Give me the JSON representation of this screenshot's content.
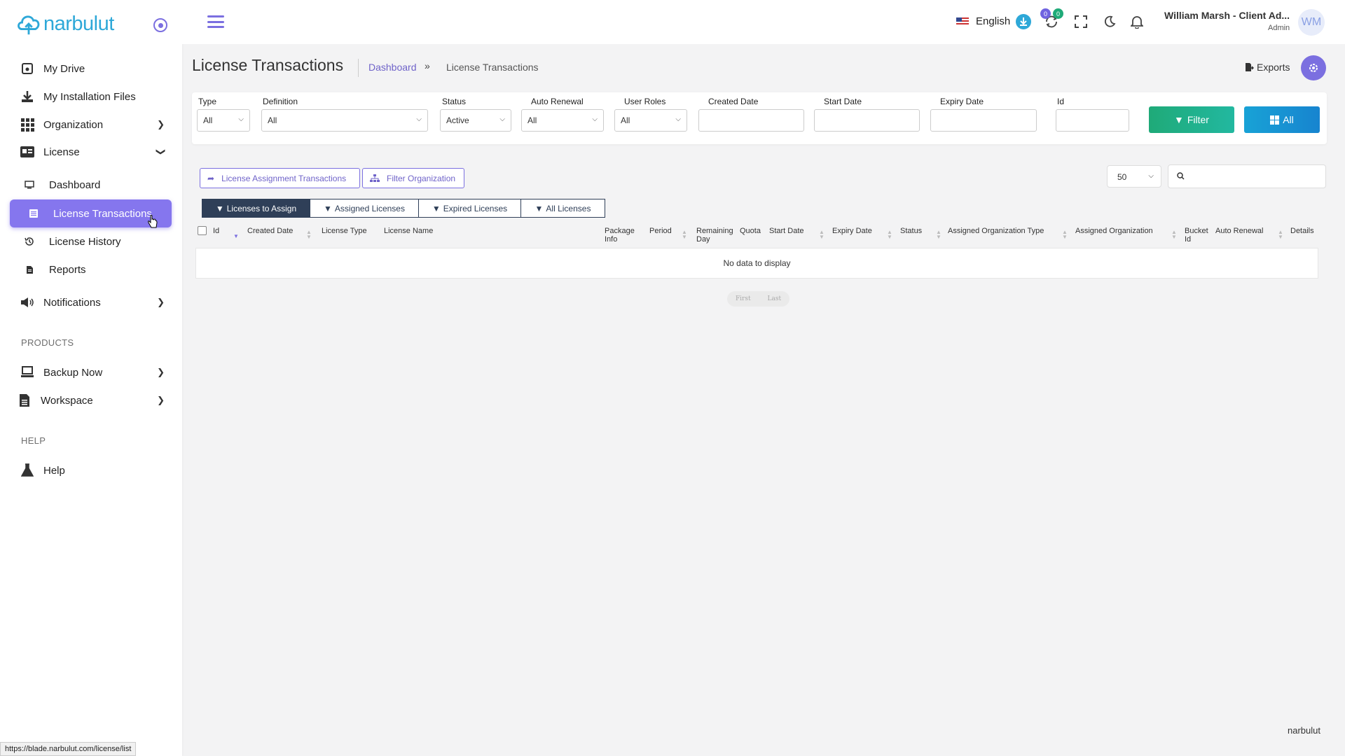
{
  "brand": {
    "name": "narbulut",
    "footer": "narbulut"
  },
  "sidebar": {
    "items": [
      {
        "label": "My Drive",
        "icon": "drive-icon"
      },
      {
        "label": "My Installation Files",
        "icon": "download-icon"
      },
      {
        "label": "Organization",
        "icon": "grid-icon"
      },
      {
        "label": "License",
        "icon": "id-card-icon"
      }
    ],
    "license_sub": [
      {
        "label": "Dashboard",
        "icon": "monitor-icon"
      },
      {
        "label": "License Transactions",
        "icon": "list-icon"
      },
      {
        "label": "License History",
        "icon": "history-icon"
      },
      {
        "label": "Reports",
        "icon": "document-icon"
      }
    ],
    "notifications": "Notifications",
    "section_products": "PRODUCTS",
    "products": [
      {
        "label": "Backup Now",
        "icon": "backup-icon"
      },
      {
        "label": "Workspace",
        "icon": "workspace-icon"
      }
    ],
    "section_help": "HELP",
    "help": "Help"
  },
  "status_url": "https://blade.narbulut.com/license/list",
  "topbar": {
    "language": "English",
    "badge_a": "0",
    "badge_b": "0",
    "user_name": "William Marsh - Client Ad...",
    "user_role": "Admin",
    "avatar_initials": "WM"
  },
  "page": {
    "title": "License Transactions",
    "breadcrumb": [
      "Dashboard",
      "»",
      "License Transactions"
    ],
    "exports": "Exports"
  },
  "filters": {
    "type": {
      "label": "Type",
      "value": "All"
    },
    "definition": {
      "label": "Definition",
      "value": "All"
    },
    "status": {
      "label": "Status",
      "value": "Active"
    },
    "auto_renewal": {
      "label": "Auto Renewal",
      "value": "All"
    },
    "user_roles": {
      "label": "User Roles",
      "value": "All"
    },
    "created_date": {
      "label": "Created Date"
    },
    "start_date": {
      "label": "Start Date"
    },
    "expiry_date": {
      "label": "Expiry Date"
    },
    "id": {
      "label": "Id"
    },
    "filter_button": "Filter",
    "all_button": "All"
  },
  "actions": {
    "assignment_transactions": "License Assignment Transactions",
    "filter_organization": "Filter Organization",
    "page_size": "50"
  },
  "tabs": [
    "Licenses to Assign",
    "Assigned Licenses",
    "Expired Licenses",
    "All Licenses"
  ],
  "table": {
    "columns": [
      "Id",
      "Created Date",
      "License Type",
      "License Name",
      "Package Info",
      "Period",
      "Remaining Day",
      "Quota",
      "Start Date",
      "Expiry Date",
      "Status",
      "Assigned Organization Type",
      "Assigned Organization",
      "Bucket Id",
      "Auto Renewal",
      "Details"
    ],
    "empty": "No data to display",
    "pager_first": "First",
    "pager_last": "Last"
  },
  "colors": {
    "accent": "#7b6fe0",
    "active_nav": "#8576ee",
    "filter_btn": "#1faa78",
    "all_btn": "#1784cf",
    "tab_dark": "#2f3f58"
  }
}
